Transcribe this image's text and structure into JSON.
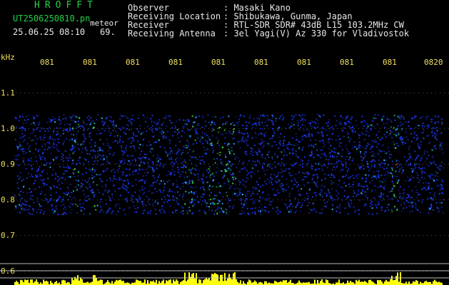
{
  "header": {
    "brand": "HROFFT",
    "filename": "UT2506250810.pn",
    "mode_label": "meteor",
    "datetime": "25.06.25 08:10",
    "count": "69."
  },
  "info": [
    {
      "label": "Observer",
      "value": ": Masaki Kano"
    },
    {
      "label": "Receiving Location",
      "value": ": Shibukawa, Gunma, Japan"
    },
    {
      "label": "Receiver",
      "value": ": RTL-SDR SDR# 43dB L15 103.2MHz CW"
    },
    {
      "label": "Receiving Antenna",
      "value": ": 3el Yagi(V) Az 330 for Vladivostok"
    }
  ],
  "axis": {
    "unit": "kHz",
    "time_ticks": [
      "081",
      "081",
      "081",
      "081",
      "081",
      "081",
      "081",
      "081",
      "081",
      "0820"
    ],
    "freq_ticks": [
      "1.1",
      "1.0",
      "0.9",
      "0.8",
      "0.7",
      "0.6"
    ]
  },
  "colors": {
    "header_green": "#22d24a",
    "text_white": "#e8e8e8",
    "tick_yellow": "#f0e060",
    "signal_blue": "#1e3cff",
    "signal_cyan": "#2ad6ff",
    "signal_green": "#4cff3c",
    "signal_red": "#ff3030",
    "meter_yellow": "#ffff10"
  }
}
